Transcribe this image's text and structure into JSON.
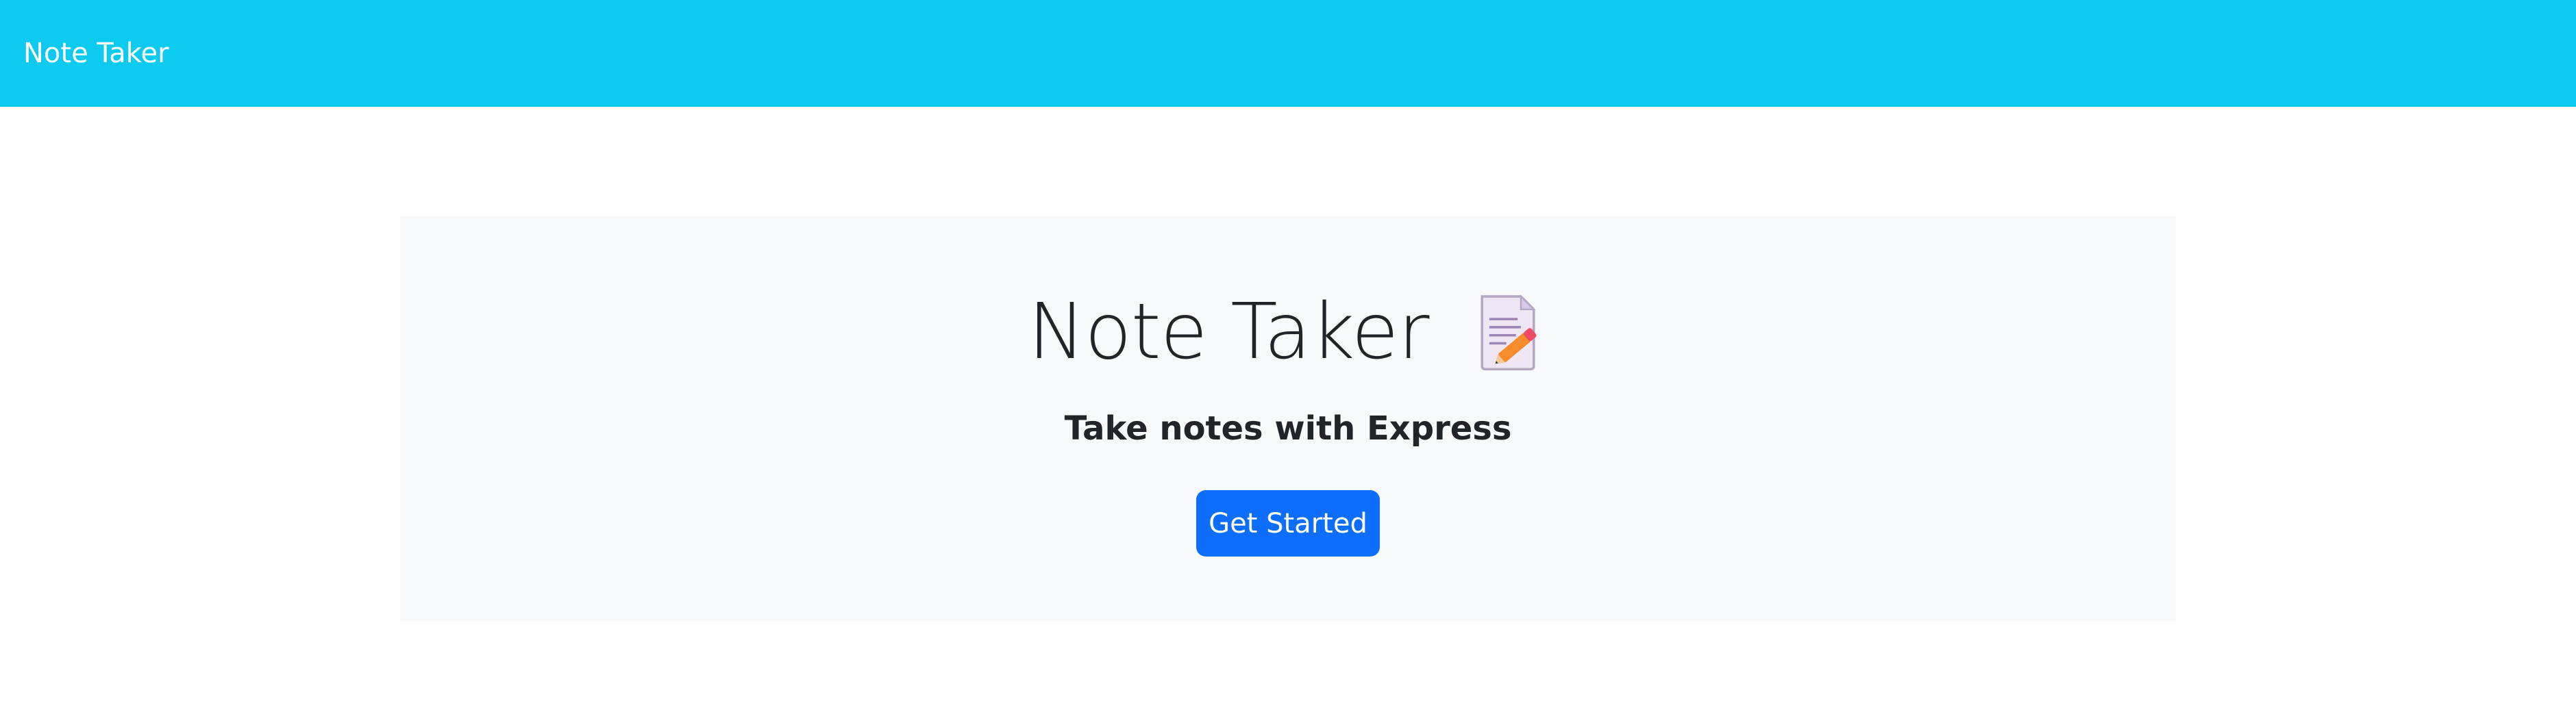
{
  "navbar": {
    "brand": "Note Taker",
    "background_color": "#0dcaf0"
  },
  "hero": {
    "title": "Note Taker",
    "title_icon": "memo-icon",
    "subtitle": "Take notes with Express",
    "cta_label": "Get Started",
    "cta_color": "#0d6efd",
    "background_color": "#f8f9fa"
  }
}
